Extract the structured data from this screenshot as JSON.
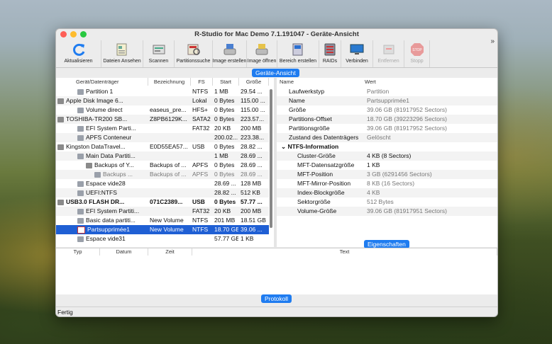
{
  "window": {
    "title": "R-Studio for Mac Demo 7.1.191047 - Geräte-Ansicht"
  },
  "toolbar": [
    {
      "label": "Aktualisieren",
      "icon": "refresh-icon",
      "enabled": true
    },
    {
      "label": "Dateien Ansehen",
      "icon": "files-icon",
      "enabled": true
    },
    {
      "label": "Scannen",
      "icon": "scan-icon",
      "enabled": true
    },
    {
      "label": "Partitionssuche",
      "icon": "partition-search-icon",
      "enabled": true
    },
    {
      "label": "Image erstellen",
      "icon": "create-image-icon",
      "enabled": true
    },
    {
      "label": "Image öffnen",
      "icon": "open-image-icon",
      "enabled": true
    },
    {
      "label": "Bereich erstellen",
      "icon": "create-region-icon",
      "enabled": true
    },
    {
      "label": "RAIDs",
      "icon": "raid-icon",
      "enabled": true
    },
    {
      "label": "Verbinden",
      "icon": "connect-icon",
      "enabled": true
    },
    {
      "label": "Entfernen",
      "icon": "remove-icon",
      "enabled": false
    },
    {
      "label": "Stopp",
      "icon": "stop-icon",
      "enabled": false
    }
  ],
  "tabs": {
    "device_view": "Geräte-Ansicht",
    "properties": "Eigenschaften",
    "log": "Protokoll"
  },
  "device_columns": [
    "Gerät/Datenträger",
    "Bezeichnung",
    "FS",
    "Start",
    "Größe"
  ],
  "devices": [
    {
      "name": "Partition 1",
      "label": "",
      "fs": "NTFS",
      "start": "1 MB",
      "size": "29.54 ...",
      "indent": 1,
      "bold": false,
      "grey": false
    },
    {
      "name": "Apple Disk Image 6...",
      "label": "",
      "fs": "Lokal",
      "start": "0 Bytes",
      "size": "115.00 ...",
      "indent": 0,
      "bold": false,
      "grey": false
    },
    {
      "name": "Volume direct",
      "label": "easeus_pre...",
      "fs": "HFS+",
      "start": "0 Bytes",
      "size": "115.00 ...",
      "indent": 1,
      "bold": false,
      "grey": false
    },
    {
      "name": "TOSHIBA-TR200 SB...",
      "label": "Z8PB6129K...",
      "fs": "SATA2",
      "start": "0 Bytes",
      "size": "223.57...",
      "indent": 0,
      "bold": false,
      "grey": false
    },
    {
      "name": "EFI System Parti...",
      "label": "",
      "fs": "FAT32",
      "start": "20 KB",
      "size": "200 MB",
      "indent": 1,
      "bold": false,
      "grey": false
    },
    {
      "name": "APFS Conteneur",
      "label": "",
      "fs": "",
      "start": "200.02...",
      "size": "223.38...",
      "indent": 1,
      "bold": false,
      "grey": false
    },
    {
      "name": "Kingston DataTravel...",
      "label": "E0D55EA57...",
      "fs": "USB",
      "start": "0 Bytes",
      "size": "28.82 ...",
      "indent": 0,
      "bold": false,
      "grey": false
    },
    {
      "name": "Main Data Partiti...",
      "label": "",
      "fs": "",
      "start": "1 MB",
      "size": "28.69 ...",
      "indent": 1,
      "bold": false,
      "grey": false
    },
    {
      "name": "Backups of Y...",
      "label": "Backups of ...",
      "fs": "APFS",
      "start": "0 Bytes",
      "size": "28.69 ...",
      "indent": 2,
      "bold": false,
      "grey": false
    },
    {
      "name": "Backups ...",
      "label": "Backups of ...",
      "fs": "APFS",
      "start": "0 Bytes",
      "size": "28.69 ...",
      "indent": 3,
      "bold": false,
      "grey": true
    },
    {
      "name": "Espace vide28",
      "label": "",
      "fs": "",
      "start": "28.69 ...",
      "size": "128 MB",
      "indent": 1,
      "bold": false,
      "grey": false
    },
    {
      "name": "UEFI:NTFS",
      "label": "",
      "fs": "",
      "start": "28.82 ...",
      "size": "512 KB",
      "indent": 1,
      "bold": false,
      "grey": false
    },
    {
      "name": "USB3.0 FLASH DR...",
      "label": "071C2389...",
      "fs": "USB",
      "start": "0 Bytes",
      "size": "57.77 ...",
      "indent": 0,
      "bold": true,
      "grey": false
    },
    {
      "name": "EFI System Partiti...",
      "label": "",
      "fs": "FAT32",
      "start": "20 KB",
      "size": "200 MB",
      "indent": 1,
      "bold": false,
      "grey": false
    },
    {
      "name": "Basic data partiti...",
      "label": "New Volume",
      "fs": "NTFS",
      "start": "201 MB",
      "size": "18.51 GB",
      "indent": 1,
      "bold": false,
      "grey": false
    },
    {
      "name": "Partsupprimée1",
      "label": "New Volume",
      "fs": "NTFS",
      "start": "18.70 GB",
      "size": "39.06 ...",
      "indent": 1,
      "bold": false,
      "grey": false,
      "selected": true
    },
    {
      "name": "Espace vide31",
      "label": "",
      "fs": "",
      "start": "57.77 GB",
      "size": "1 KB",
      "indent": 1,
      "bold": false,
      "grey": false
    }
  ],
  "property_columns": [
    "Name",
    "Wert"
  ],
  "properties": [
    {
      "name": "Laufwerkstyp",
      "value": "Partition",
      "grey": true,
      "indent": 0
    },
    {
      "name": "Name",
      "value": "Partsupprimée1",
      "grey": true,
      "indent": 0
    },
    {
      "name": "Größe",
      "value": "39.06 GB (81917952 Sectors)",
      "grey": true,
      "indent": 0
    },
    {
      "name": "Partitions-Offset",
      "value": "18.70 GB (39223296 Sectors)",
      "grey": true,
      "indent": 0
    },
    {
      "name": "Partitionsgröße",
      "value": "39.06 GB (81917952 Sectors)",
      "grey": true,
      "indent": 0
    },
    {
      "name": "Zustand des Datenträgers",
      "value": "Gelöscht",
      "grey": true,
      "indent": 0
    },
    {
      "name": "NTFS-Information",
      "value": "",
      "grey": false,
      "indent": 0,
      "group": true
    },
    {
      "name": "Cluster-Größe",
      "value": "4 KB (8 Sectors)",
      "grey": false,
      "indent": 1
    },
    {
      "name": "MFT-Datensatzgröße",
      "value": "1 KB",
      "grey": false,
      "indent": 1
    },
    {
      "name": "MFT-Position",
      "value": "3 GB (6291456 Sectors)",
      "grey": true,
      "indent": 1
    },
    {
      "name": "MFT-Mirror-Position",
      "value": "8 KB (16 Sectors)",
      "grey": true,
      "indent": 1
    },
    {
      "name": "Index-Blockgröße",
      "value": "4 KB",
      "grey": true,
      "indent": 1
    },
    {
      "name": "Sektorgröße",
      "value": "512 Bytes",
      "grey": true,
      "indent": 1
    },
    {
      "name": "Volume-Größe",
      "value": "39.06 GB (81917951 Sectors)",
      "grey": true,
      "indent": 1
    }
  ],
  "log_columns": [
    "Typ",
    "Datum",
    "Zeit",
    "Text"
  ],
  "status": "Fertig",
  "colors": {
    "accent": "#1f7cf0",
    "selection": "#1f5fd4"
  }
}
